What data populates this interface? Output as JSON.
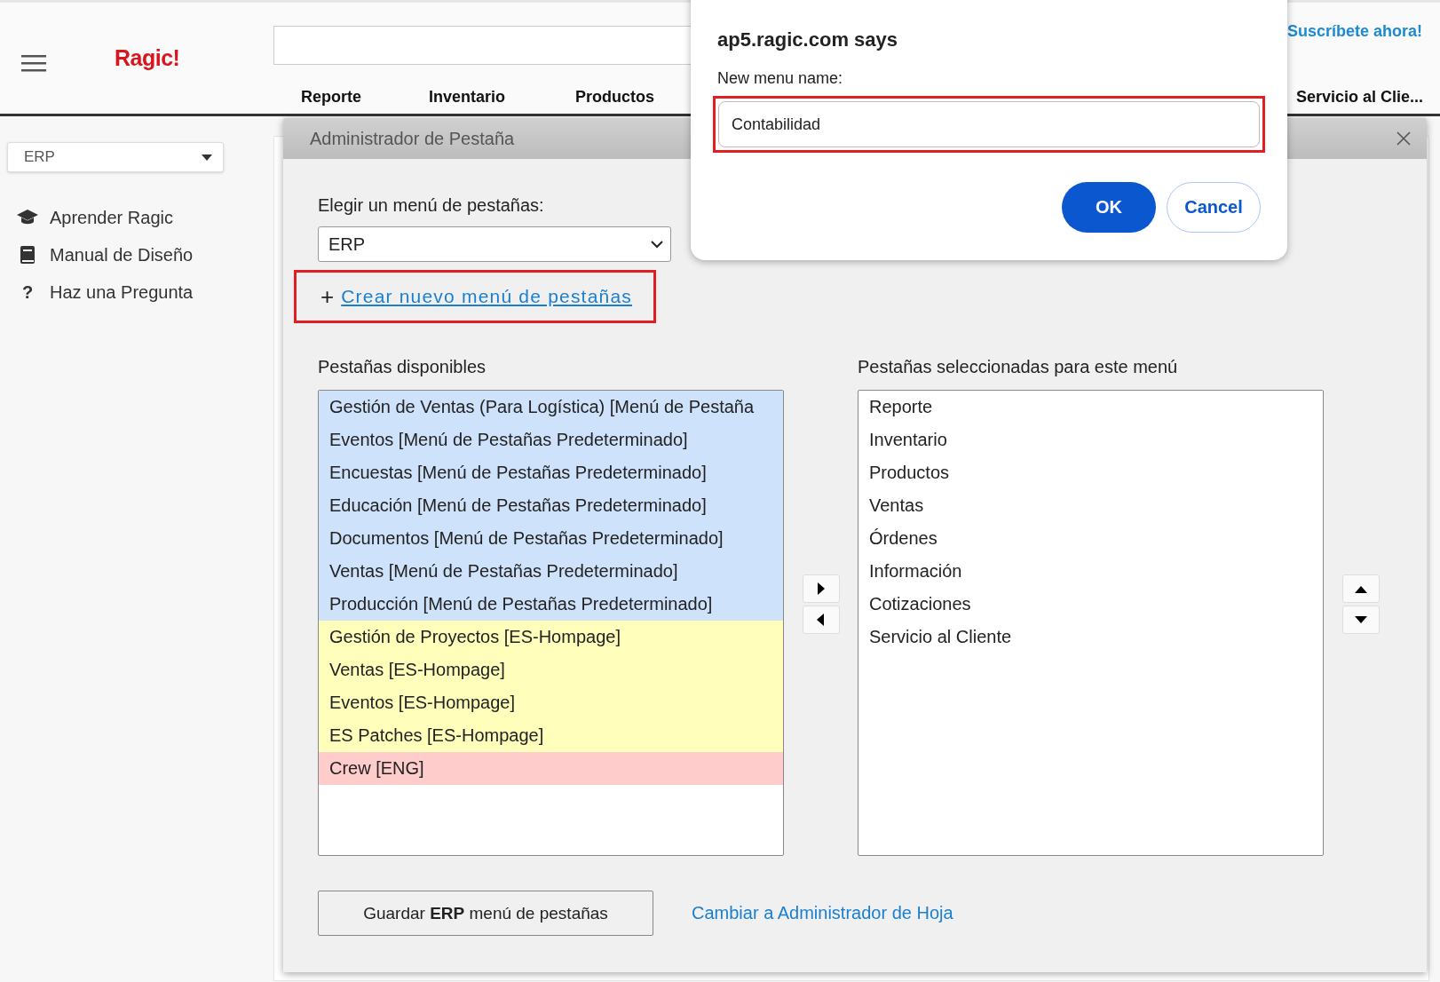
{
  "header": {
    "logo": "Ragic!",
    "subscribe_link": "Suscríbete ahora!",
    "tabs": [
      {
        "label": "Reporte"
      },
      {
        "label": "Inventario"
      },
      {
        "label": "Productos"
      },
      {
        "label": "Servicio al Clie..."
      }
    ]
  },
  "sidebar": {
    "menu_select": "ERP",
    "items": [
      {
        "label": "Aprender Ragic"
      },
      {
        "label": "Manual de Diseño"
      },
      {
        "label": "Haz una Pregunta",
        "glyph": "?"
      }
    ]
  },
  "tab_manager": {
    "title": "Administrador de Pestaña",
    "choose_label": "Elegir un menú de pestañas:",
    "menu_select": "ERP",
    "create_link": {
      "plus": "+",
      "label": "Crear nuevo menú de pestañas",
      "highlighted": true
    },
    "available_title": "Pestañas disponibles",
    "available": [
      {
        "label": "Gestión de Ventas (Para Logística) [Menú de Pestaña",
        "color": "#cfe2fb"
      },
      {
        "label": "Eventos [Menú de Pestañas Predeterminado]",
        "color": "#cfe2fb"
      },
      {
        "label": "Encuestas [Menú de Pestañas Predeterminado]",
        "color": "#cfe2fb"
      },
      {
        "label": "Educación [Menú de Pestañas Predeterminado]",
        "color": "#cfe2fb"
      },
      {
        "label": "Documentos [Menú de Pestañas Predeterminado]",
        "color": "#cfe2fb"
      },
      {
        "label": "Ventas [Menú de Pestañas Predeterminado]",
        "color": "#cfe2fb"
      },
      {
        "label": "Producción [Menú de Pestañas Predeterminado]",
        "color": "#cfe2fb"
      },
      {
        "label": "Gestión de Proyectos [ES-Hompage]",
        "color": "#ffffbb"
      },
      {
        "label": "Ventas [ES-Hompage]",
        "color": "#ffffbb"
      },
      {
        "label": "Eventos [ES-Hompage]",
        "color": "#ffffbb"
      },
      {
        "label": "ES Patches [ES-Hompage]",
        "color": "#ffffbb"
      },
      {
        "label": "Crew [ENG]",
        "color": "#ffcccc"
      }
    ],
    "selected_title": "Pestañas seleccionadas para este menú",
    "selected_tabs": [
      "Reporte",
      "Inventario",
      "Productos",
      "Ventas",
      "Órdenes",
      "Información",
      "Cotizaciones",
      "Servicio al Cliente"
    ],
    "save_button": "Guardar **ERP** menú de pestañas",
    "switch_link": "Cambiar a Administrador de Hoja"
  },
  "prompt": {
    "title": "ap5.ragic.com says",
    "label": "New menu name:",
    "value": "Contabilidad",
    "highlighted": true,
    "ok": "OK",
    "cancel": "Cancel"
  }
}
